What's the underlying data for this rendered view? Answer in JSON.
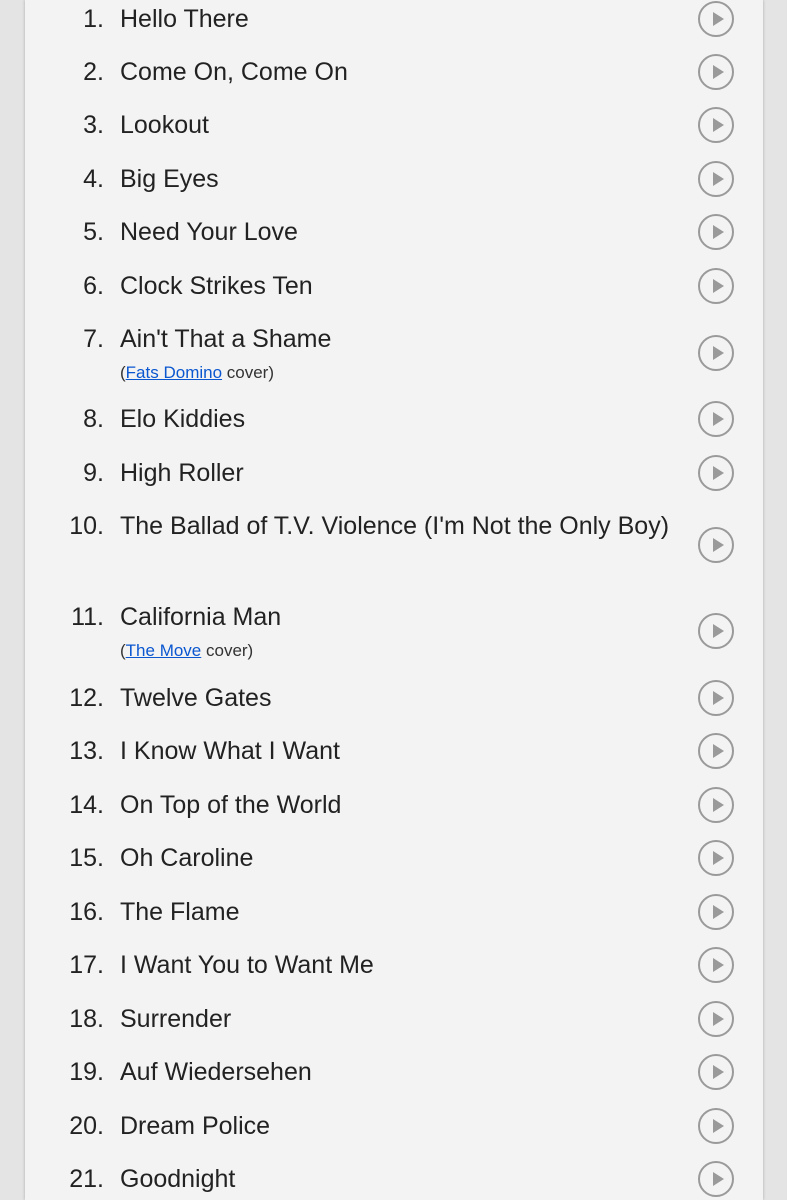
{
  "tracks": [
    {
      "number": "1.",
      "title": "Hello There"
    },
    {
      "number": "2.",
      "title": "Come On, Come On"
    },
    {
      "number": "3.",
      "title": "Lookout"
    },
    {
      "number": "4.",
      "title": "Big Eyes"
    },
    {
      "number": "5.",
      "title": "Need Your Love"
    },
    {
      "number": "6.",
      "title": "Clock Strikes Ten"
    },
    {
      "number": "7.",
      "title": "Ain't That a Shame",
      "note_open": "(",
      "note_link": "Fats Domino",
      "note_close": " cover)"
    },
    {
      "number": "8.",
      "title": "Elo Kiddies"
    },
    {
      "number": "9.",
      "title": "High Roller"
    },
    {
      "number": "10.",
      "title": "The Ballad of T.V. Violence (I'm Not the Only Boy)"
    },
    {
      "number": "11.",
      "title": "California Man",
      "note_open": "(",
      "note_link": "The Move",
      "note_close": " cover)"
    },
    {
      "number": "12.",
      "title": "Twelve Gates"
    },
    {
      "number": "13.",
      "title": "I Know What I Want"
    },
    {
      "number": "14.",
      "title": "On Top of the World"
    },
    {
      "number": "15.",
      "title": "Oh Caroline"
    },
    {
      "number": "16.",
      "title": "The Flame"
    },
    {
      "number": "17.",
      "title": "I Want You to Want Me"
    },
    {
      "number": "18.",
      "title": "Surrender"
    },
    {
      "number": "19.",
      "title": "Auf Wiedersehen"
    },
    {
      "number": "20.",
      "title": "Dream Police"
    },
    {
      "number": "21.",
      "title": "Goodnight"
    }
  ],
  "play_icon": "play-circle-icon",
  "colors": {
    "link": "#0b57d0",
    "icon": "#9a9a9a",
    "text": "#222222",
    "page": "#f3f3f3"
  }
}
